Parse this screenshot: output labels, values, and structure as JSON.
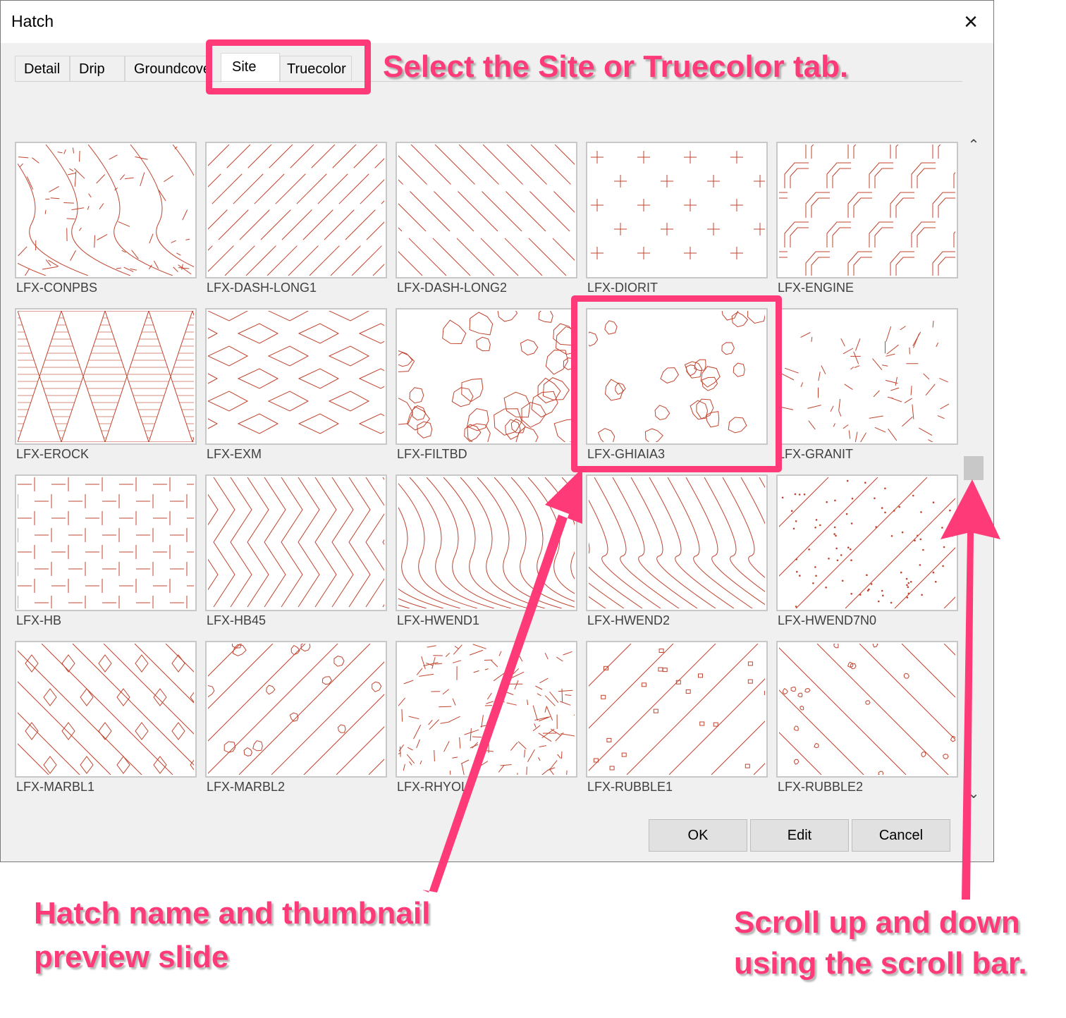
{
  "window": {
    "title": "Hatch",
    "close_icon": "×"
  },
  "tabs": [
    {
      "label": "Detail",
      "active": false
    },
    {
      "label": "Drip",
      "active": false
    },
    {
      "label": "Groundcove",
      "active": false
    },
    {
      "label": "Site",
      "active": true
    },
    {
      "label": "Truecolor",
      "active": false
    }
  ],
  "hatches": [
    "LFX-CONPBS",
    "LFX-DASH-LONG1",
    "LFX-DASH-LONG2",
    "LFX-DIORIT",
    "LFX-ENGINE",
    "LFX-EROCK",
    "LFX-EXM",
    "LFX-FILTBD",
    "LFX-GHIAIA3",
    "LFX-GRANIT",
    "LFX-HB",
    "LFX-HB45",
    "LFX-HWEND1",
    "LFX-HWEND2",
    "LFX-HWEND7N0",
    "LFX-MARBL1",
    "LFX-MARBL2",
    "LFX-RHYOLT",
    "LFX-RUBBLE1",
    "LFX-RUBBLE2"
  ],
  "scrollbar": {
    "up_icon": "⌃",
    "down_icon": "⌄"
  },
  "buttons": {
    "ok": "OK",
    "edit": "Edit",
    "cancel": "Cancel"
  },
  "annotations": {
    "tab_tip": "Select the Site or Truecolor tab.",
    "thumbnail_tip_line1": "Hatch name and thumbnail",
    "thumbnail_tip_line2": "preview slide",
    "scroll_tip_line1": "Scroll up and down",
    "scroll_tip_line2": "using the scroll bar."
  },
  "colors": {
    "hatch_stroke": "#c0442e",
    "annotation": "#ff3a78"
  }
}
